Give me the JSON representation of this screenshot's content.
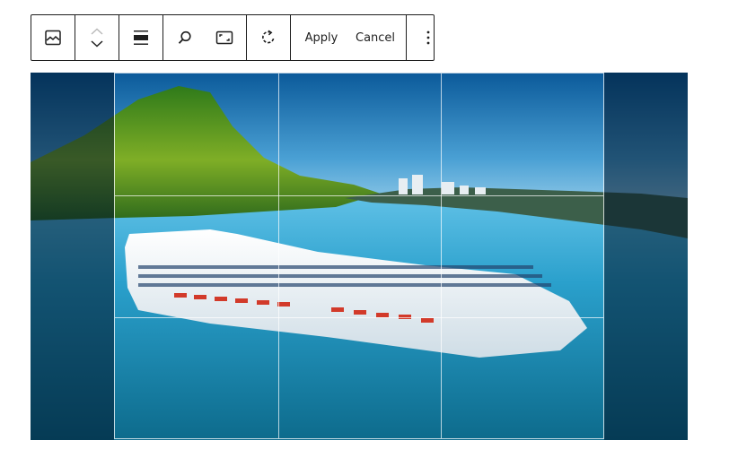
{
  "toolbar": {
    "groups": [
      {
        "id": "block-type",
        "icon": "image-icon",
        "label": "Image"
      },
      {
        "id": "mover",
        "up_icon": "chevron-up-icon",
        "down_icon": "chevron-down-icon"
      },
      {
        "id": "align",
        "icon": "align-wide-icon"
      },
      {
        "id": "zoom-aspect",
        "zoom_icon": "zoom-icon",
        "aspect_icon": "aspect-ratio-icon"
      },
      {
        "id": "rotate",
        "icon": "rotate-icon"
      },
      {
        "id": "actions",
        "apply_label": "Apply",
        "cancel_label": "Cancel"
      },
      {
        "id": "more",
        "icon": "more-vertical-icon"
      }
    ],
    "apply_label": "Apply",
    "cancel_label": "Cancel"
  },
  "image": {
    "description": "Cruise ship sailing in blue harbor with green mountain and coastal town",
    "colors": {
      "sky_top": "#0b5a9a",
      "sky_bottom": "#7fc3e6",
      "mountain": "#4f8f1f",
      "water": "#1f93c0",
      "deep_water": "#0e6f8e",
      "ship_hull": "#f1f5f7"
    }
  },
  "crop": {
    "grid": "rule-of-thirds"
  }
}
